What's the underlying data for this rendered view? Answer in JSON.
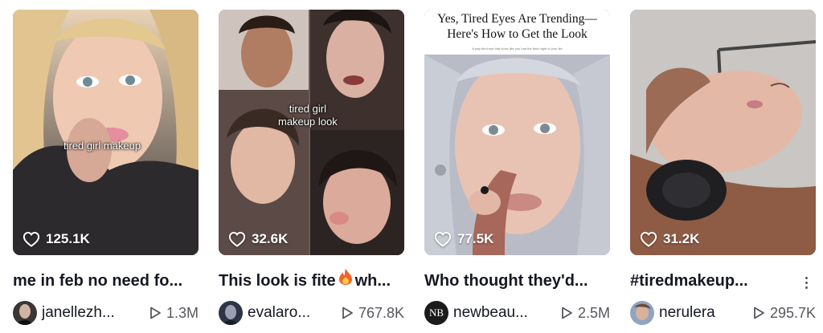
{
  "videos": [
    {
      "overlay": "tired girl makeup",
      "likes": "125.1K",
      "caption": "me in feb no need fo...",
      "username": "janellezh...",
      "views": "1.3M"
    },
    {
      "overlay": "tired girl\nmakeup look",
      "likes": "32.6K",
      "caption": "This look is fite",
      "caption_suffix": "wh...",
      "username": "evalaro...",
      "views": "767.8K"
    },
    {
      "headline": "Yes, Tired Eyes Are Trending—\nHere's How to Get the Look",
      "subhead": "A way tired eye that looks like you had the best night of your life",
      "likes": "77.5K",
      "caption": "Who thought they'd...",
      "username": "newbeau...",
      "avatar_text": "NB",
      "views": "2.5M"
    },
    {
      "likes": "31.2K",
      "caption": "#tiredmakeup...",
      "username": "nerulera",
      "views": "295.7K"
    }
  ],
  "icons": {
    "like": "heart-outline-icon",
    "views": "play-outline-icon",
    "more": "more-vertical-icon",
    "fire": "fire-emoji-icon"
  },
  "colors": {
    "text": "#161823",
    "secondary": "#56575c",
    "overlay_text": "#ffffff"
  }
}
